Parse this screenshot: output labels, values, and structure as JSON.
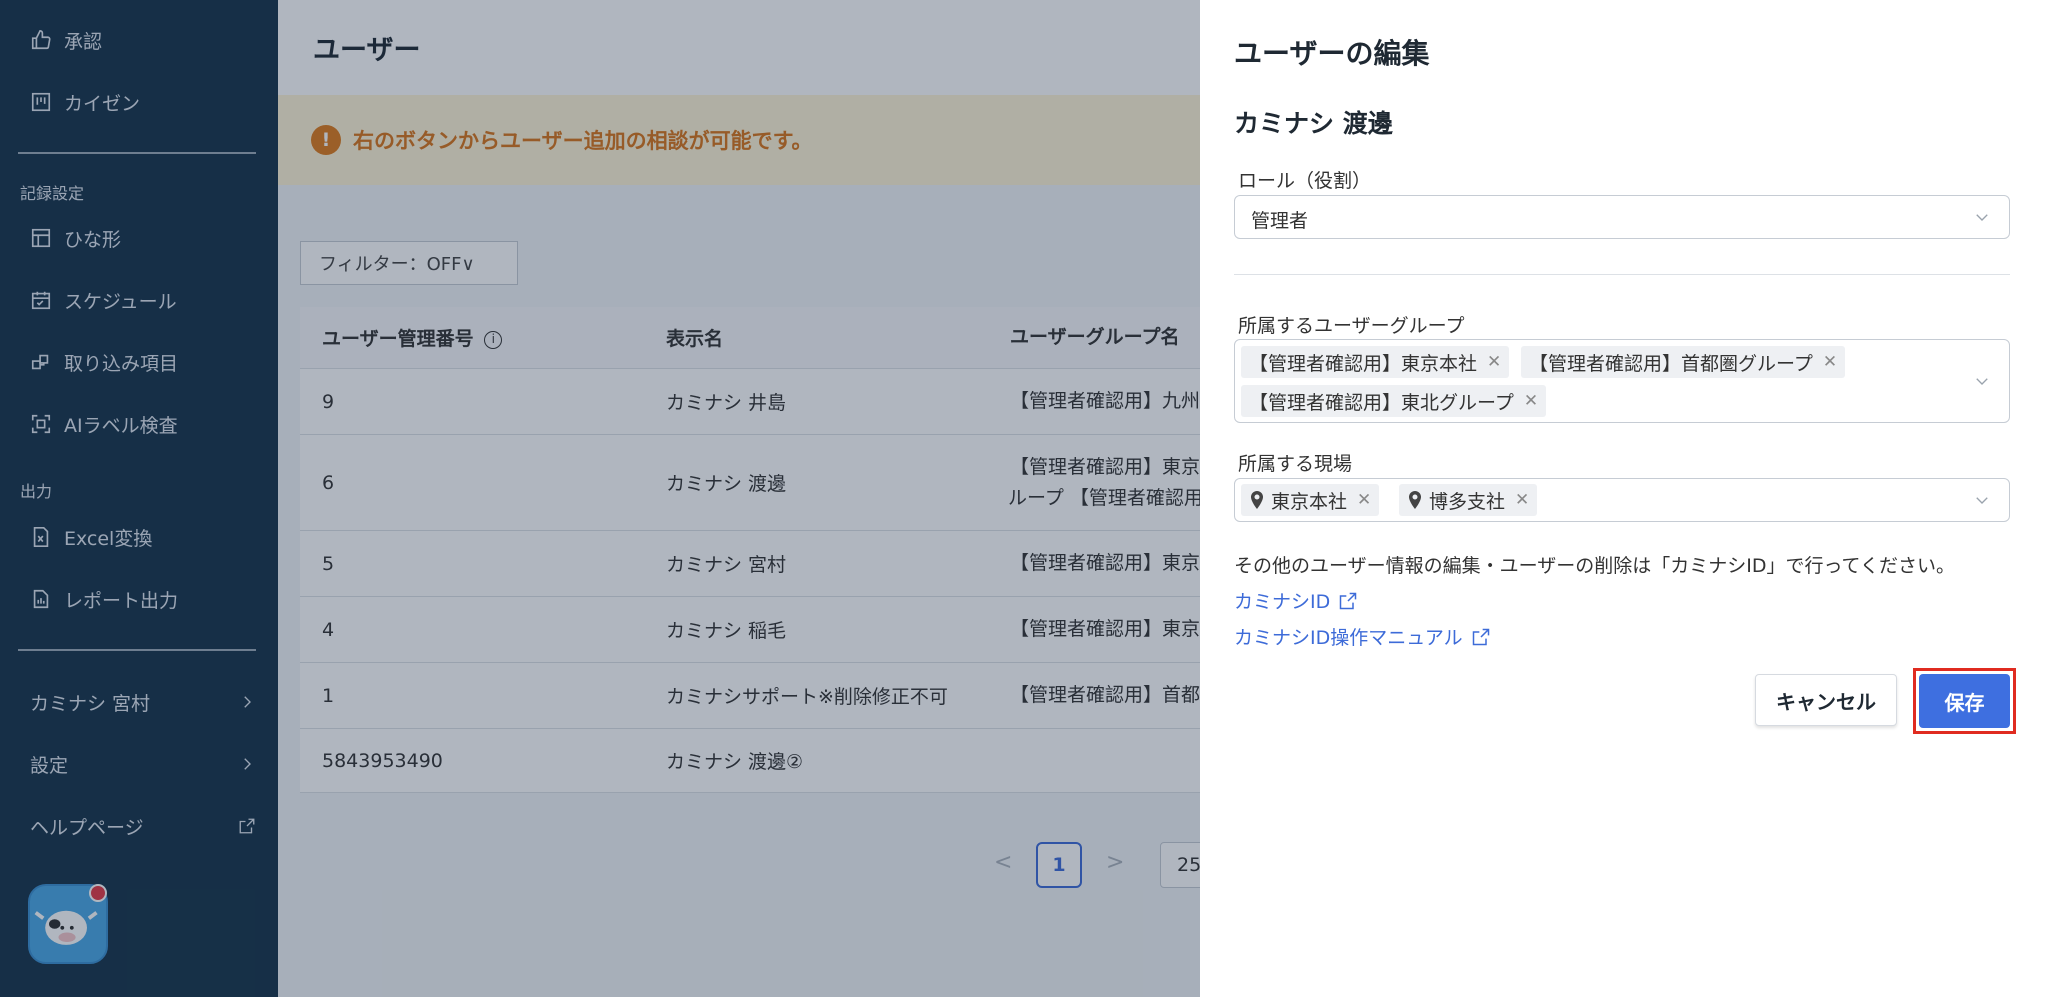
{
  "sidebar": {
    "items_top": [
      {
        "label": "承認",
        "icon": "thumbs-up-icon"
      },
      {
        "label": "カイゼン",
        "icon": "kanban-icon"
      }
    ],
    "section_record": "記録設定",
    "items_record": [
      {
        "label": "ひな形",
        "icon": "template-icon"
      },
      {
        "label": "スケジュール",
        "icon": "calendar-icon"
      },
      {
        "label": "取り込み項目",
        "icon": "import-icon"
      },
      {
        "label": "AIラベル検査",
        "icon": "ai-scan-icon"
      }
    ],
    "section_output": "出力",
    "items_output": [
      {
        "label": "Excel変換",
        "icon": "excel-file-icon"
      },
      {
        "label": "レポート出力",
        "icon": "report-icon"
      }
    ],
    "user_label": "カミナシ 宮村",
    "settings_label": "設定",
    "help_label": "ヘルプページ"
  },
  "main": {
    "title": "ユーザー",
    "alert_icon": "!",
    "alert_text": "右のボタンからユーザー追加の相談が可能です。",
    "filter_label": "フィルター：OFF∨",
    "columns": [
      "ユーザー管理番号",
      "表示名",
      "ユーザーグループ名"
    ],
    "rows": [
      {
        "id": "9",
        "name": "カミナシ 井島",
        "group_line1": "【管理者確認用】九州",
        "group_line2": ""
      },
      {
        "id": "6",
        "name": "カミナシ 渡邊",
        "group_line1": "【管理者確認用】東京",
        "group_line2": "ループ 【管理者確認用"
      },
      {
        "id": "5",
        "name": "カミナシ 宮村",
        "group_line1": "【管理者確認用】東京",
        "group_line2": ""
      },
      {
        "id": "4",
        "name": "カミナシ 稲毛",
        "group_line1": "【管理者確認用】東京",
        "group_line2": ""
      },
      {
        "id": "1",
        "name": "カミナシサポート※削除修正不可",
        "group_line1": "【管理者確認用】首都",
        "group_line2": ""
      },
      {
        "id": "5843953490",
        "name": "カミナシ 渡邊②",
        "group_line1": "",
        "group_line2": ""
      }
    ],
    "pager": {
      "prev": "<",
      "current": "1",
      "next": ">",
      "page_size": "25"
    }
  },
  "drawer": {
    "title": "ユーザーの編集",
    "user_name": "カミナシ 渡邊",
    "role_label": "ロール（役割）",
    "role_value": "管理者",
    "groups_label": "所属するユーザーグループ",
    "groups": [
      "【管理者確認用】東京本社",
      "【管理者確認用】首都圏グループ",
      "【管理者確認用】東北グループ"
    ],
    "sites_label": "所属する現場",
    "sites": [
      "東京本社",
      "博多支社"
    ],
    "info_text": "その他のユーザー情報の編集・ユーザーの削除は「カミナシID」で行ってください。",
    "link1": "カミナシID",
    "link2": "カミナシID操作マニュアル",
    "cancel_label": "キャンセル",
    "save_label": "保存"
  },
  "colors": {
    "sidebar_bg": "#16334a",
    "accent": "#3e6fe0",
    "alert_text": "#d9761b",
    "highlight": "#e02b20"
  }
}
